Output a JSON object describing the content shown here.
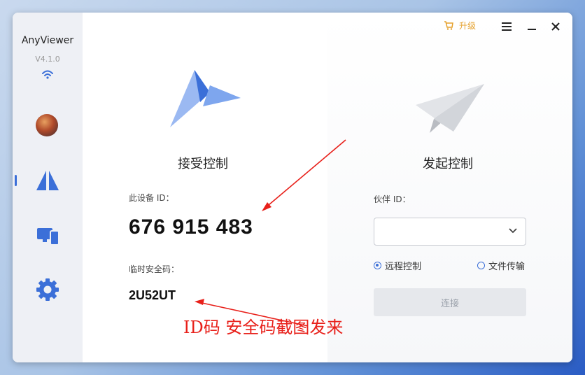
{
  "sidebar": {
    "app_name": "AnyViewer",
    "version": "V4.1.0",
    "items": [
      {
        "icon": "avatar"
      },
      {
        "icon": "remote-control-icon",
        "active": true
      },
      {
        "icon": "devices-icon"
      },
      {
        "icon": "gear-icon"
      }
    ]
  },
  "topbar": {
    "upgrade_label": "升级",
    "menu_icon": "menu-icon",
    "minimize_icon": "minimize-icon",
    "close_icon": "close-icon",
    "accent_color": "#e5a02a"
  },
  "receive": {
    "title": "接受控制",
    "device_id_label": "此设备 ID：",
    "device_id": "676 915 483",
    "temp_code_label": "临时安全码：",
    "temp_code": "2U52UT"
  },
  "initiate": {
    "title": "发起控制",
    "partner_id_label": "伙伴 ID：",
    "partner_id_value": "",
    "mode_options": [
      {
        "label": "远程控制",
        "selected": true
      },
      {
        "label": "文件传输",
        "selected": false
      }
    ],
    "connect_label": "连接"
  },
  "annotation": {
    "text": "ID码  安全码截图发来",
    "color": "#e8201a"
  }
}
